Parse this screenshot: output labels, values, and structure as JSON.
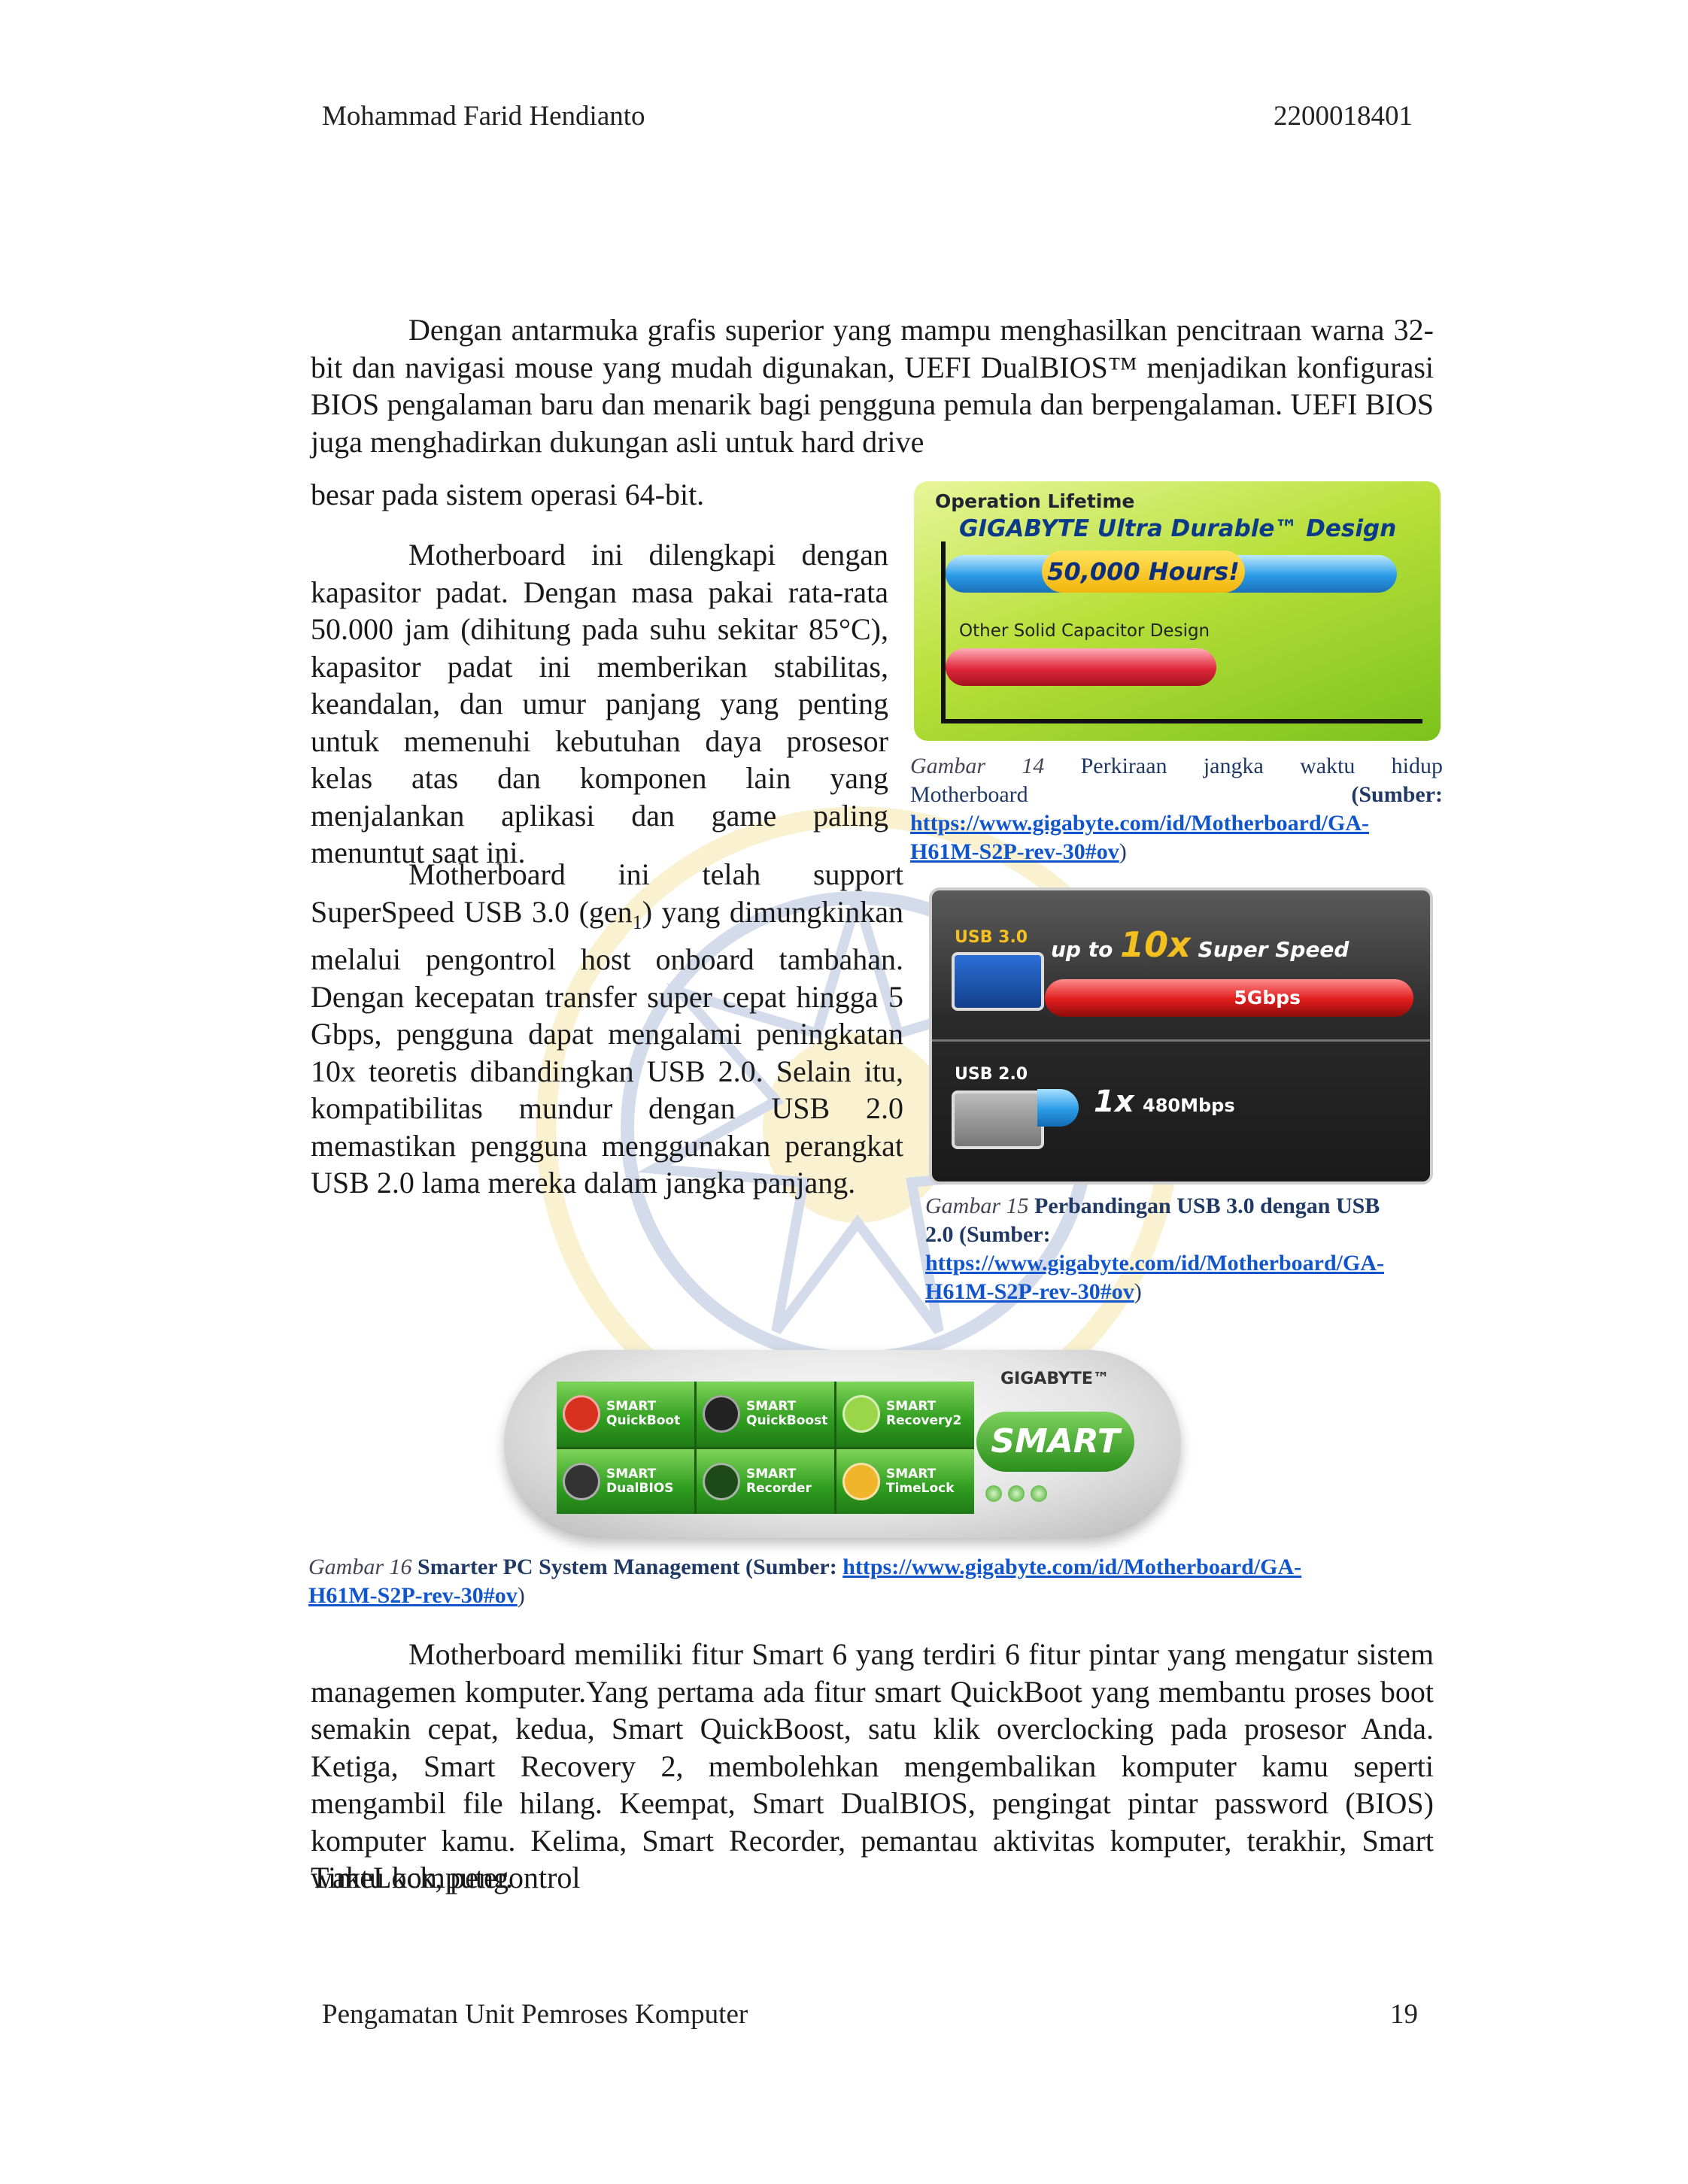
{
  "header": {
    "author": "Mohammad Farid Hendianto",
    "student_id": "2200018401"
  },
  "paragraphs": {
    "p1": "Dengan antarmuka grafis superior yang mampu menghasilkan pencitraan warna 32-bit dan navigasi mouse yang mudah digunakan, UEFI DualBIOS™ menjadikan konfigurasi BIOS pengalaman baru dan menarik bagi pengguna pemula dan berpengalaman. UEFI BIOS juga menghadirkan dukungan asli untuk hard drive",
    "p1_last": "besar pada sistem operasi 64-bit.",
    "p2": "Motherboard ini dilengkapi dengan kapasitor padat. Dengan masa pakai rata-rata 50.000 jam (dihitung pada suhu sekitar 85°C), kapasitor padat ini memberikan stabilitas, keandalan, dan umur panjang yang penting untuk memenuhi kebutuhan daya prosesor kelas atas dan komponen lain yang menjalankan aplikasi dan game paling menuntut saat ini.",
    "p3_a": "Motherboard ini telah support SuperSpeed USB 3.0 (gen",
    "p3_sub": "1",
    "p3_b": ") yang dimungkinkan melalui pengontrol host onboard tambahan. Dengan kecepatan transfer super cepat hingga 5 Gbps, pengguna dapat mengalami peningkatan 10x teoretis dibandingkan USB 2.0. Selain itu, kompatibilitas mundur dengan USB 2.0 memastikan pengguna menggunakan perangkat USB 2.0 lama mereka dalam jangka panjang.",
    "p4": "Motherboard memiliki fitur Smart 6 yang terdiri 6 fitur pintar yang mengatur sistem managemen komputer.Yang pertama ada fitur smart QuickBoot yang membantu proses boot semakin cepat, kedua, Smart QuickBoost, satu klik overclocking pada prosesor Anda. Ketiga, Smart Recovery 2, membolehkan mengembalikan komputer kamu seperti mengambil file hilang. Keempat, Smart DualBIOS,  pengingat pintar password (BIOS) komputer kamu. Kelima, Smart Recorder, pemantau aktivitas komputer, terakhir, Smart TimeLock, pengontrol",
    "p4_last": "waktu komputer."
  },
  "figure14": {
    "title": "Operation Lifetime",
    "subtitle": "GIGABYTE Ultra Durable™ Design",
    "bar1_label": "50,000 Hours!",
    "bar2_label": "Other Solid Capacitor Design",
    "caption_prefix": "Gambar 14",
    "caption_text": "Perkiraan jangka waktu hidup",
    "caption_line2_a": "Motherboard",
    "caption_line2_b": "(Sumber:",
    "link_line1": "https://www.gigabyte.com/id/Motherboard/GA-",
    "link_line2": "H61M-S2P-rev-30#ov",
    "close_paren": ")"
  },
  "figure15": {
    "usb3_label": "USB 3.0",
    "usb2_label": "USB 2.0",
    "speed_prefix": "up to",
    "speed_mult": "10x",
    "speed_suffix": "Super Speed",
    "usb3_rate": "5Gbps",
    "usb2_mult": "1x",
    "usb2_rate": "480Mbps",
    "caption_prefix": "Gambar 15",
    "caption_text": "Perbandingan USB 3.0 dengan USB",
    "caption_line2": "2.0 (Sumber:",
    "link_line1": "https://www.gigabyte.com/id/Motherboard/GA-",
    "link_line2": "H61M-S2P-rev-30#ov",
    "close_paren": ")"
  },
  "figure16": {
    "brand": "GIGABYTE™",
    "logo": "SMART",
    "tiles": [
      {
        "l1": "SMART",
        "l2": "QuickBoot",
        "color": "#d8321f"
      },
      {
        "l1": "SMART",
        "l2": "QuickBoost",
        "color": "#222222"
      },
      {
        "l1": "SMART",
        "l2": "Recovery2",
        "color": "#9bd64a"
      },
      {
        "l1": "SMART",
        "l2": "DualBIOS",
        "color": "#333333"
      },
      {
        "l1": "SMART",
        "l2": "Recorder",
        "color": "#1e4a1a"
      },
      {
        "l1": "SMART",
        "l2": "TimeLock",
        "color": "#f0b52a"
      }
    ],
    "caption_prefix": "Gambar 16",
    "caption_text": "Smarter PC System Management (Sumber:",
    "link_line1": "https://www.gigabyte.com/id/Motherboard/GA-",
    "link_line2": "H61M-S2P-rev-30#ov",
    "close_paren": ")"
  },
  "footer": {
    "title": "Pengamatan Unit Pemroses Komputer",
    "page_number": "19"
  }
}
